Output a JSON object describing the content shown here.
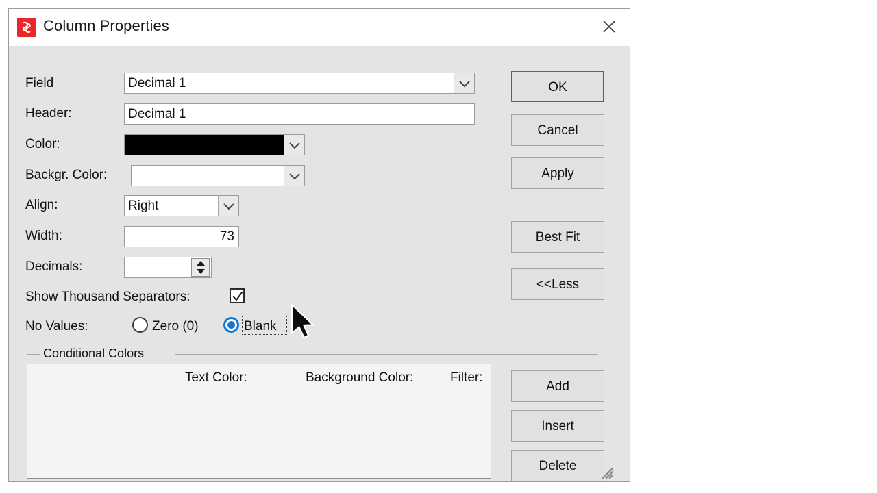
{
  "window": {
    "title": "Column Properties",
    "icon": "app-swirl-icon",
    "close_label": "✕",
    "accent": "#e8282b",
    "titlebar_bg": "#ffffff",
    "client_bg": "#e4e4e4"
  },
  "form": {
    "field": {
      "label": "Field",
      "value": "Decimal 1"
    },
    "header": {
      "label": "Header:",
      "value": "Decimal 1"
    },
    "color": {
      "label": "Color:",
      "value": "#000000"
    },
    "backgr_color": {
      "label": "Backgr. Color:",
      "value": "#ffffff"
    },
    "align": {
      "label": "Align:",
      "value": "Right"
    },
    "width": {
      "label": "Width:",
      "value": "73"
    },
    "decimals": {
      "label": "Decimals:",
      "value": ""
    },
    "show_thousand_separators": {
      "label": "Show Thousand Separators:",
      "checked": true
    },
    "no_values": {
      "label": "No Values:",
      "options": [
        {
          "label": "Zero (0)",
          "selected": false
        },
        {
          "label": "Blank",
          "selected": true
        }
      ],
      "selected_accent": "#1676d4"
    }
  },
  "conditional_colors": {
    "group_title": "Conditional Colors",
    "columns": [
      "Text Color:",
      "Background Color:",
      "Filter:"
    ],
    "rows": []
  },
  "buttons": {
    "ok": "OK",
    "cancel": "Cancel",
    "apply": "Apply",
    "best_fit": "Best Fit",
    "less": "<<Less",
    "add": "Add",
    "insert": "Insert",
    "delete": "Delete",
    "default_focus_color": "#1272d0"
  }
}
